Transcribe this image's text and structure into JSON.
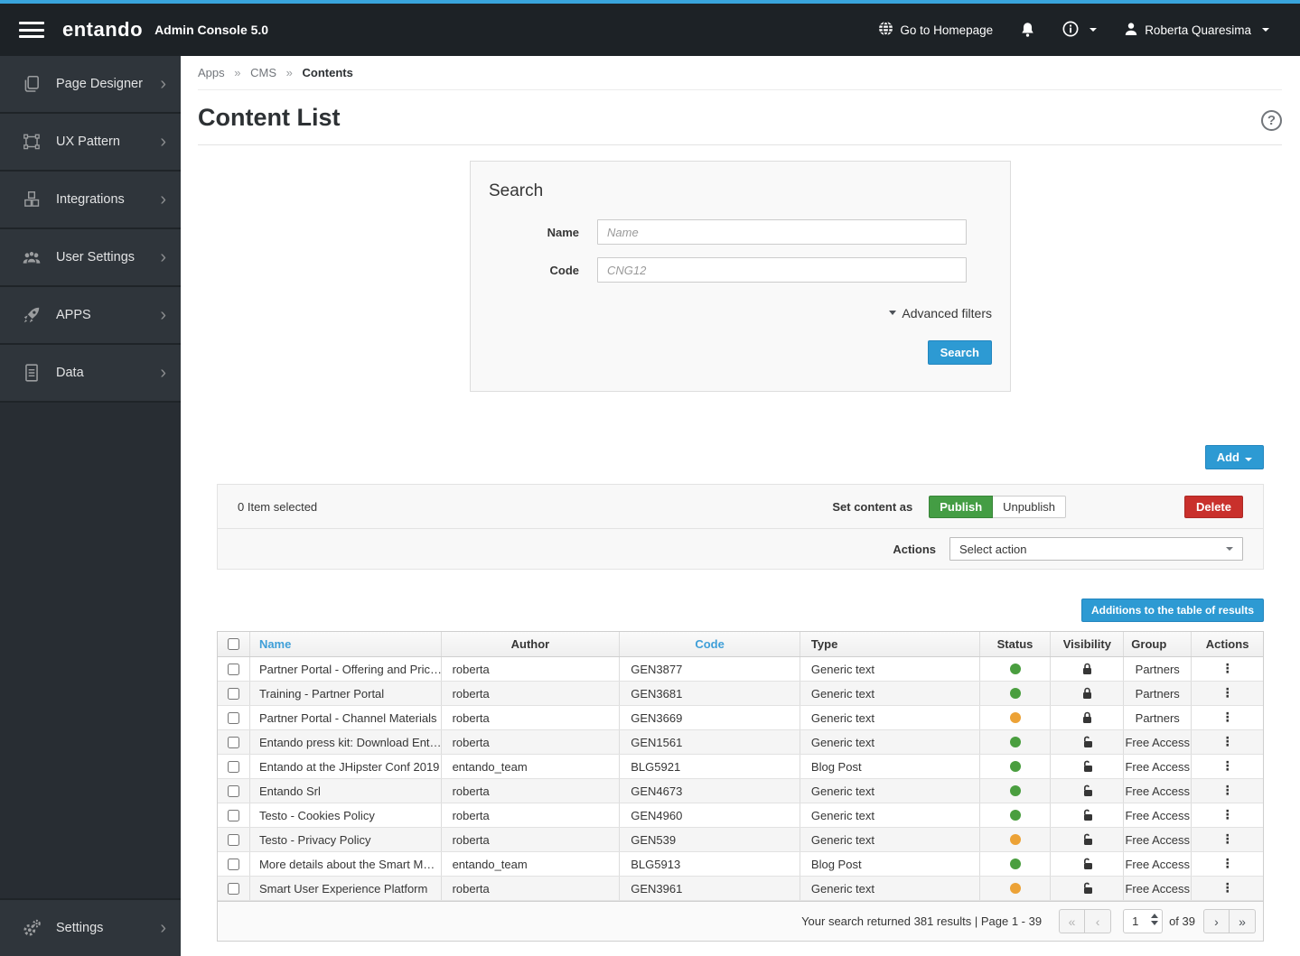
{
  "navbar": {
    "brand": "entando",
    "subtitle": "Admin Console 5.0",
    "homepage_label": "Go to Homepage",
    "user_name": "Roberta Quaresima"
  },
  "sidebar": {
    "items": [
      {
        "label": "Page Designer",
        "icon": "page-designer-icon"
      },
      {
        "label": "UX Pattern",
        "icon": "ux-pattern-icon"
      },
      {
        "label": "Integrations",
        "icon": "integrations-icon"
      },
      {
        "label": "User Settings",
        "icon": "user-settings-icon"
      },
      {
        "label": "APPS",
        "icon": "apps-rocket-icon"
      },
      {
        "label": "Data",
        "icon": "data-document-icon"
      }
    ],
    "chevron": "›",
    "settings_label": "Settings"
  },
  "breadcrumb": {
    "items": [
      "Apps",
      "CMS"
    ],
    "separator": "»",
    "current": "Contents"
  },
  "page": {
    "title": "Content List",
    "help_glyph": "?"
  },
  "search_panel": {
    "title": "Search",
    "name_label": "Name",
    "name_placeholder": "Name",
    "name_value": "",
    "code_label": "Code",
    "code_placeholder": "CNG12",
    "code_value": "",
    "advanced_filters_label": "Advanced filters",
    "search_button": "Search"
  },
  "toolbar": {
    "add_label": "Add",
    "selected_text": "0 Item selected",
    "set_content_as_label": "Set content as",
    "publish_label": "Publish",
    "unpublish_label": "Unpublish",
    "delete_label": "Delete",
    "actions_label": "Actions",
    "select_action_value": "Select action",
    "additions_button": "Additions to the table of results"
  },
  "table": {
    "headers": {
      "name": "Name",
      "author": "Author",
      "code": "Code",
      "type": "Type",
      "status": "Status",
      "visibility": "Visibility",
      "group": "Group",
      "actions": "Actions"
    },
    "rows": [
      {
        "name": "Partner Portal - Offering and Pric…",
        "author": "roberta",
        "code": "GEN3877",
        "type": "Generic text",
        "status": "green",
        "visibility": "locked",
        "group": "Partners"
      },
      {
        "name": "Training - Partner Portal",
        "author": "roberta",
        "code": "GEN3681",
        "type": "Generic text",
        "status": "green",
        "visibility": "locked",
        "group": "Partners"
      },
      {
        "name": "Partner Portal - Channel Materials",
        "author": "roberta",
        "code": "GEN3669",
        "type": "Generic text",
        "status": "orange",
        "visibility": "locked",
        "group": "Partners"
      },
      {
        "name": "Entando press kit: Download Ent…",
        "author": "roberta",
        "code": "GEN1561",
        "type": "Generic text",
        "status": "green",
        "visibility": "unlocked",
        "group": "Free Access"
      },
      {
        "name": "Entando at the JHipster Conf 2019",
        "author": "entando_team",
        "code": "BLG5921",
        "type": "Blog Post",
        "status": "green",
        "visibility": "unlocked",
        "group": "Free Access"
      },
      {
        "name": "Entando Srl",
        "author": "roberta",
        "code": "GEN4673",
        "type": "Generic text",
        "status": "green",
        "visibility": "unlocked",
        "group": "Free Access"
      },
      {
        "name": "Testo - Cookies Policy",
        "author": "roberta",
        "code": "GEN4960",
        "type": "Generic text",
        "status": "green",
        "visibility": "unlocked",
        "group": "Free Access"
      },
      {
        "name": "Testo - Privacy Policy",
        "author": "roberta",
        "code": "GEN539",
        "type": "Generic text",
        "status": "orange",
        "visibility": "unlocked",
        "group": "Free Access"
      },
      {
        "name": "More details about the Smart M…",
        "author": "entando_team",
        "code": "BLG5913",
        "type": "Blog Post",
        "status": "green",
        "visibility": "unlocked",
        "group": "Free Access"
      },
      {
        "name": "Smart User Experience Platform",
        "author": "roberta",
        "code": "GEN3961",
        "type": "Generic text",
        "status": "orange",
        "visibility": "unlocked",
        "group": "Free Access"
      }
    ]
  },
  "pagination": {
    "summary": "Your search returned 381 results",
    "divider": "|",
    "page_info": "Page 1 - 39",
    "first_glyph": "«",
    "prev_glyph": "‹",
    "next_glyph": "›",
    "last_glyph": "»",
    "current_page": "1",
    "of_label": "of 39"
  },
  "colors": {
    "top_strip": "#39a5dc",
    "navbar_bg": "#1d2226",
    "sidebar_bg": "#282d33",
    "accent_blue": "#2d9ad3",
    "link_blue": "#3f9fd8",
    "publish_green": "#449d44",
    "delete_red": "#c9302c",
    "status_green": "#4a9e3f",
    "status_orange": "#eca236"
  }
}
